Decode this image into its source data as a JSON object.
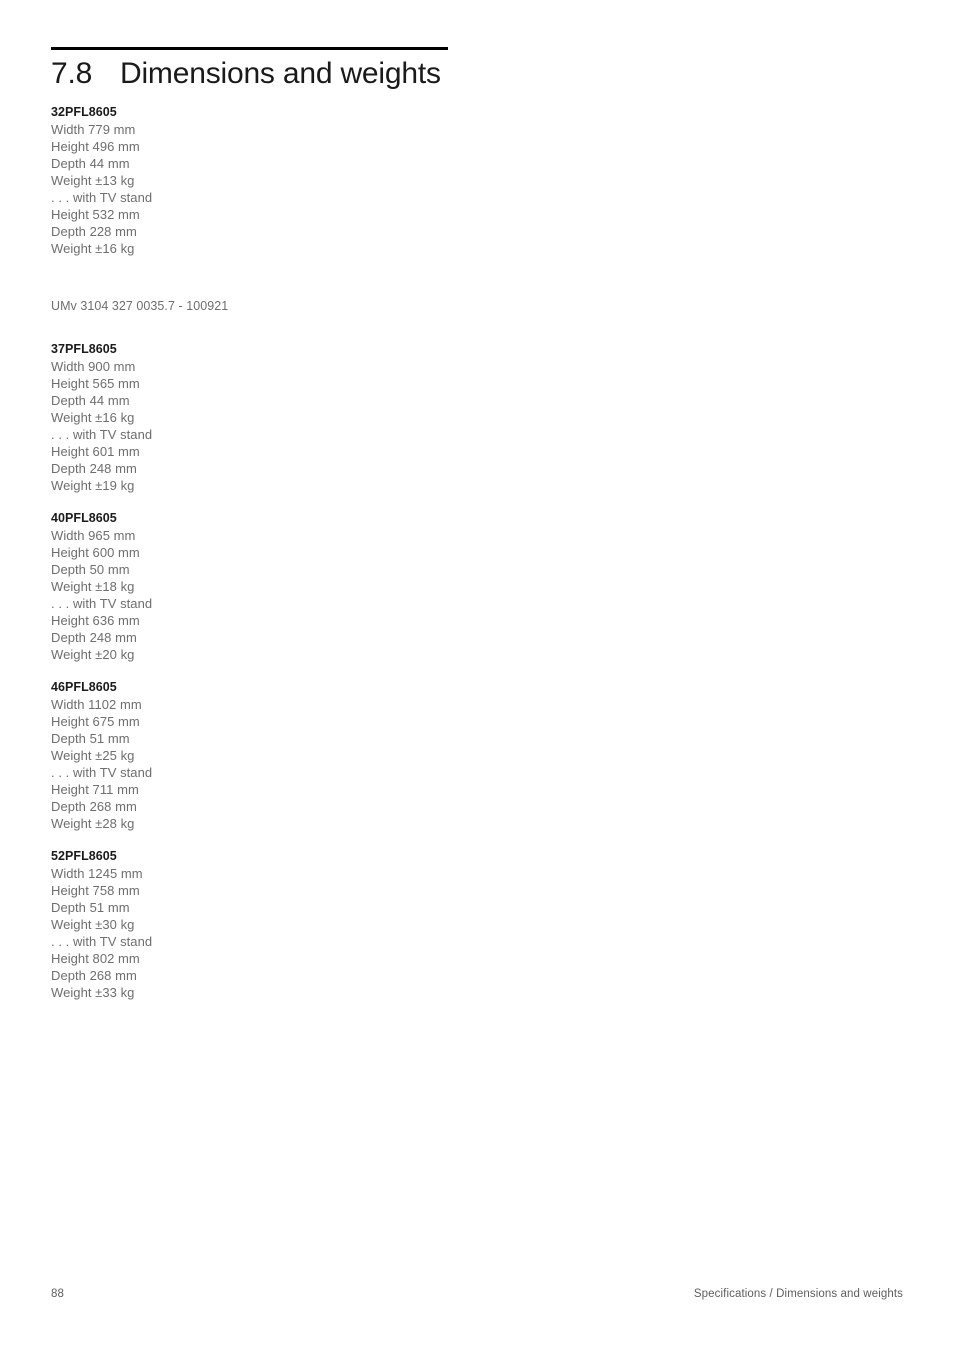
{
  "section": {
    "number": "7.8",
    "title": "Dimensions and weights"
  },
  "umv": "UMv 3104 327 0035.7 - 100921",
  "spec_blocks": [
    {
      "model": "32PFL8605",
      "lines": [
        "Width 779 mm",
        "Height 496 mm",
        "Depth 44 mm",
        "Weight ±13 kg",
        ". . . with TV stand",
        "Height 532 mm",
        "Depth 228 mm",
        "Weight ±16 kg"
      ]
    },
    {
      "model": "37PFL8605",
      "lines": [
        "Width 900 mm",
        "Height 565 mm",
        "Depth 44 mm",
        "Weight ±16 kg",
        ". . . with TV stand",
        "Height 601 mm",
        "Depth 248 mm",
        "Weight ±19 kg"
      ]
    },
    {
      "model": "40PFL8605",
      "lines": [
        "Width 965 mm",
        "Height 600 mm",
        "Depth 50 mm",
        "Weight ±18 kg",
        ". . . with TV stand",
        "Height 636 mm",
        "Depth 248 mm",
        "Weight ±20 kg"
      ]
    },
    {
      "model": "46PFL8605",
      "lines": [
        "Width 1102 mm",
        "Height 675 mm",
        "Depth 51 mm",
        "Weight ±25 kg",
        ". . . with TV stand",
        "Height 711 mm",
        "Depth 268 mm",
        "Weight ±28 kg"
      ]
    },
    {
      "model": "52PFL8605",
      "lines": [
        "Width 1245 mm",
        "Height 758 mm",
        "Depth 51 mm",
        "Weight ±30 kg",
        ". . . with TV stand",
        "Height 802 mm",
        "Depth 268 mm",
        "Weight ±33 kg"
      ]
    }
  ],
  "footer": {
    "page_number": "88",
    "breadcrumb": "Specifications / Dimensions and weights"
  },
  "colors": {
    "text_heading": "#1a1a1a",
    "text_body": "#6e6e6e",
    "rule": "#000000",
    "background": "#ffffff"
  }
}
